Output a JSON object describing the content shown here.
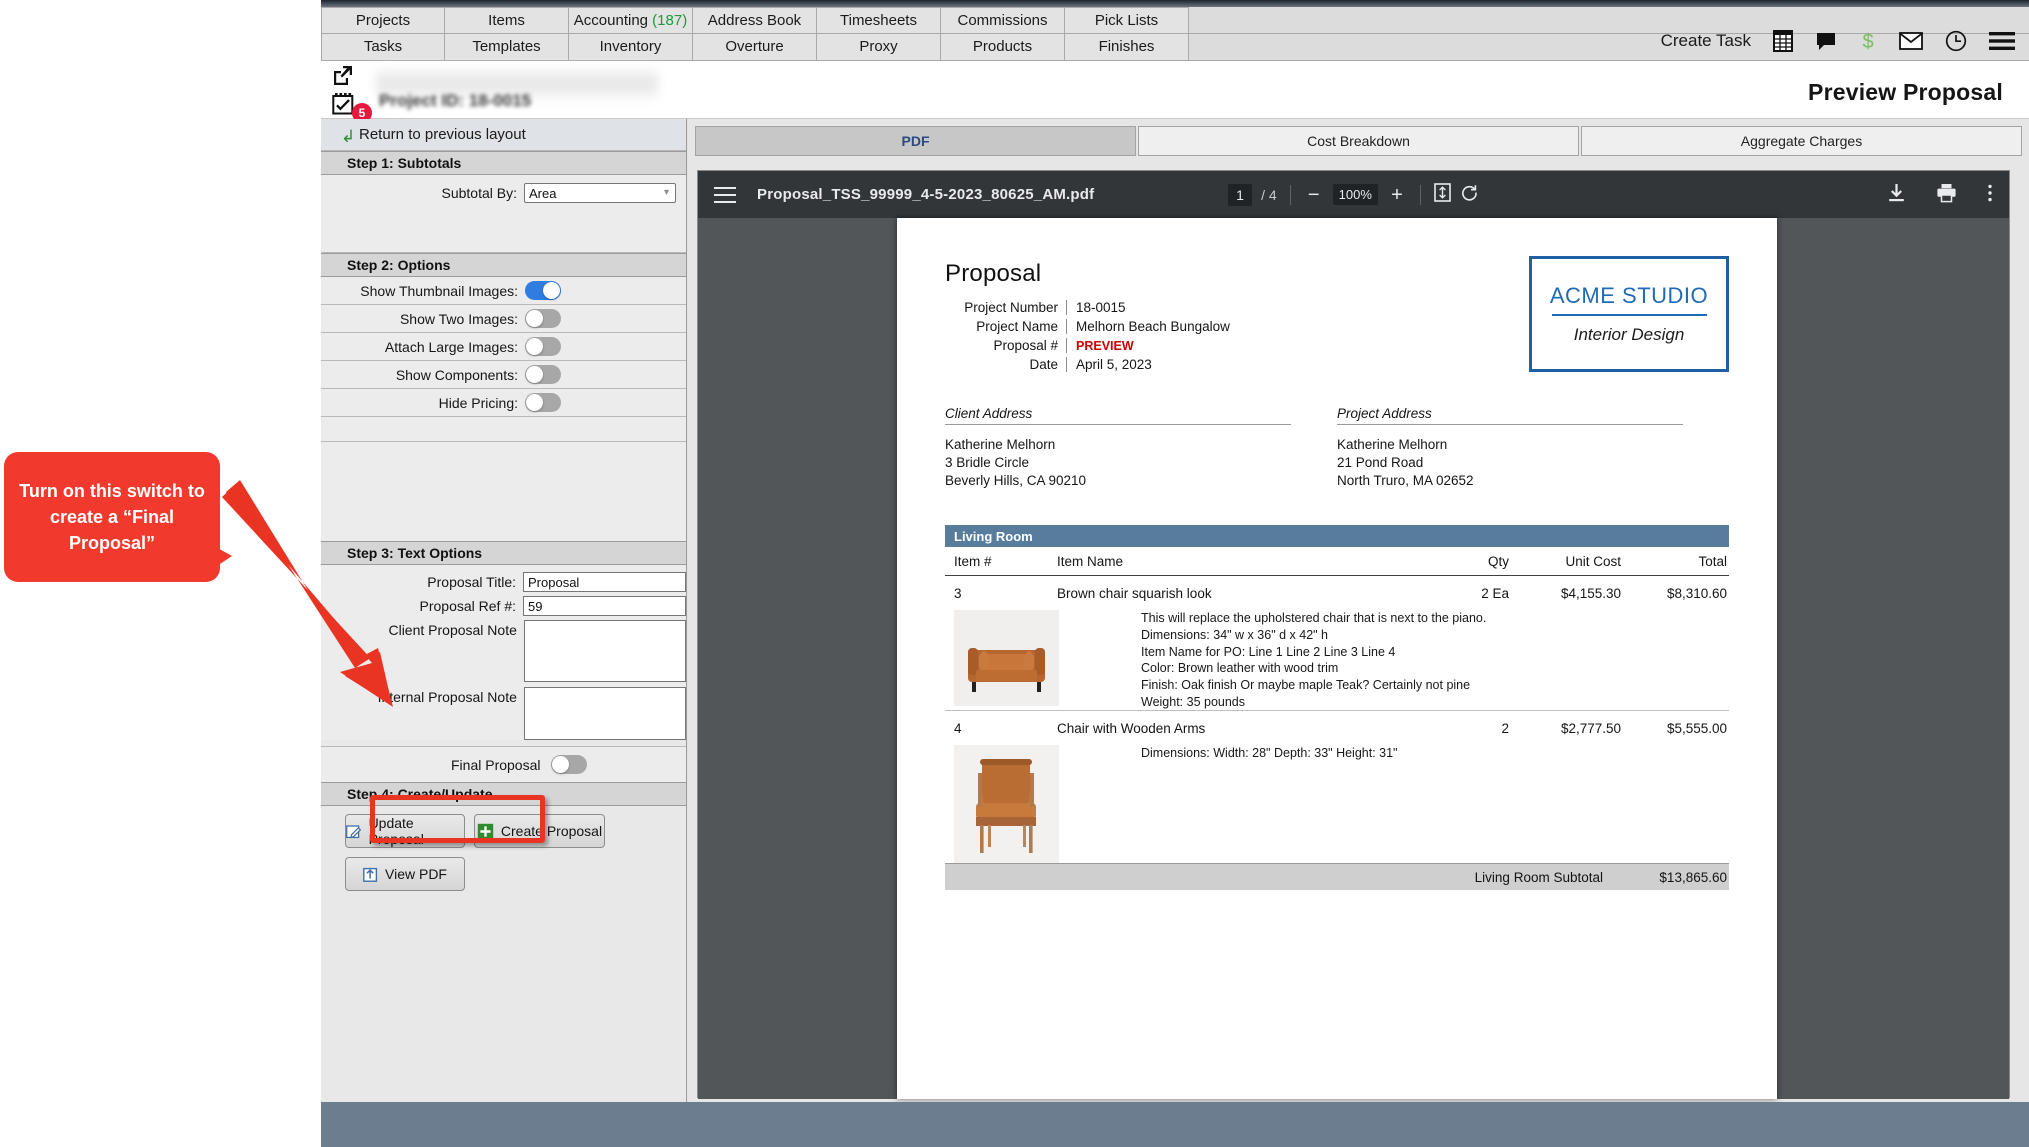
{
  "nav": {
    "row1": [
      {
        "label": "Projects"
      },
      {
        "label": "Items"
      },
      {
        "label": "Accounting",
        "badge": "(187)"
      },
      {
        "label": "Address Book"
      },
      {
        "label": "Timesheets"
      },
      {
        "label": "Commissions"
      },
      {
        "label": "Pick Lists"
      }
    ],
    "row2": [
      {
        "label": "Tasks"
      },
      {
        "label": "Templates"
      },
      {
        "label": "Inventory"
      },
      {
        "label": "Overture"
      },
      {
        "label": "Proxy"
      },
      {
        "label": "Products"
      },
      {
        "label": "Finishes"
      }
    ],
    "create_task": "Create Task",
    "icons": [
      "calendar-grid-icon",
      "chat-bubble-icon",
      "dollar-icon",
      "mail-icon",
      "clock-icon",
      "hamburger-menu-icon"
    ]
  },
  "header": {
    "project_id": "Project ID: 18-0015",
    "page_title": "Preview Proposal",
    "badge_count": "5"
  },
  "left_panel": {
    "return_label": "Return to previous layout",
    "step1": {
      "title": "Step 1: Subtotals",
      "subtotal_by_label": "Subtotal By:",
      "subtotal_by_value": "Area",
      "subtotal_by_options": [
        "Area"
      ]
    },
    "step2": {
      "title": "Step 2: Options",
      "toggles": [
        {
          "label": "Show Thumbnail Images:",
          "on": true
        },
        {
          "label": "Show Two Images:",
          "on": false
        },
        {
          "label": "Attach Large Images:",
          "on": false
        },
        {
          "label": "Show Components:",
          "on": false
        },
        {
          "label": "Hide Pricing:",
          "on": false
        }
      ]
    },
    "step3": {
      "title": "Step 3: Text Options",
      "proposal_title_label": "Proposal Title:",
      "proposal_title_value": "Proposal",
      "proposal_ref_label": "Proposal Ref #:",
      "proposal_ref_value": "59",
      "client_note_label": "Client Proposal Note",
      "client_note_value": "",
      "internal_note_label": "Internal Proposal Note",
      "internal_note_value": "",
      "final_proposal_label": "Final Proposal",
      "final_proposal_on": false
    },
    "step4": {
      "title": "Step 4: Create/Update",
      "update_button": "Update Proposal",
      "create_button": "Create Proposal",
      "view_pdf_button": "View PDF"
    }
  },
  "callout": {
    "text": "Turn on this switch to create a “Final Proposal”",
    "color": "#f2392e"
  },
  "view_tabs": [
    {
      "label": "PDF",
      "active": true
    },
    {
      "label": "Cost Breakdown",
      "active": false
    },
    {
      "label": "Aggregate Charges",
      "active": false
    }
  ],
  "pdf_toolbar": {
    "filename": "Proposal_TSS_99999_4-5-2023_80625_AM.pdf",
    "page_current": "1",
    "page_total": "/ 4",
    "zoom": "100%",
    "zoom_out": "−",
    "zoom_in": "+",
    "icons": [
      "sidebar-toggle-icon",
      "fit-page-icon",
      "rotate-icon",
      "download-icon",
      "print-icon",
      "more-options-icon"
    ]
  },
  "proposal": {
    "title": "Proposal",
    "meta": [
      {
        "key": "Project Number",
        "value": "18-0015"
      },
      {
        "key": "Project Name",
        "value": "Melhorn Beach Bungalow"
      },
      {
        "key": "Proposal #",
        "value": "PREVIEW",
        "highlight": true
      },
      {
        "key": "Date",
        "value": "April 5, 2023"
      }
    ],
    "logo": {
      "name": "ACME STUDIO",
      "sub": "Interior Design",
      "color": "#1f6bb5"
    },
    "addresses": [
      {
        "heading": "Client Address",
        "lines": [
          "Katherine Melhorn",
          "3 Bridle Circle",
          "Beverly Hills, CA 90210"
        ]
      },
      {
        "heading": "Project Address",
        "lines": [
          "Katherine Melhorn",
          "21 Pond Road",
          "North Truro, MA 02652"
        ]
      }
    ],
    "room": "Living Room",
    "columns": [
      "Item #",
      "Item Name",
      "Qty",
      "Unit Cost",
      "Total"
    ],
    "items": [
      {
        "num": "3",
        "name": "Brown chair squarish look",
        "qty": "2 Ea",
        "unit_cost": "$4,155.30",
        "total": "$8,310.60",
        "desc": [
          "This will replace the upholstered chair that is next to the piano.",
          "Dimensions: 34\" w x 36\" d x 42\" h",
          "Item Name for PO: Line 1 Line 2 Line 3 Line 4",
          "Color: Brown leather with wood trim",
          "Finish: Oak finish Or maybe maple Teak? Certainly not pine",
          "Weight: 35 pounds"
        ]
      },
      {
        "num": "4",
        "name": "Chair with Wooden Arms",
        "qty": "2",
        "unit_cost": "$2,777.50",
        "total": "$5,555.00",
        "desc": [
          "Dimensions: Width: 28\" Depth: 33\" Height: 31\""
        ]
      }
    ],
    "subtotal_label": "Living Room Subtotal",
    "subtotal_value": "$13,865.60"
  }
}
